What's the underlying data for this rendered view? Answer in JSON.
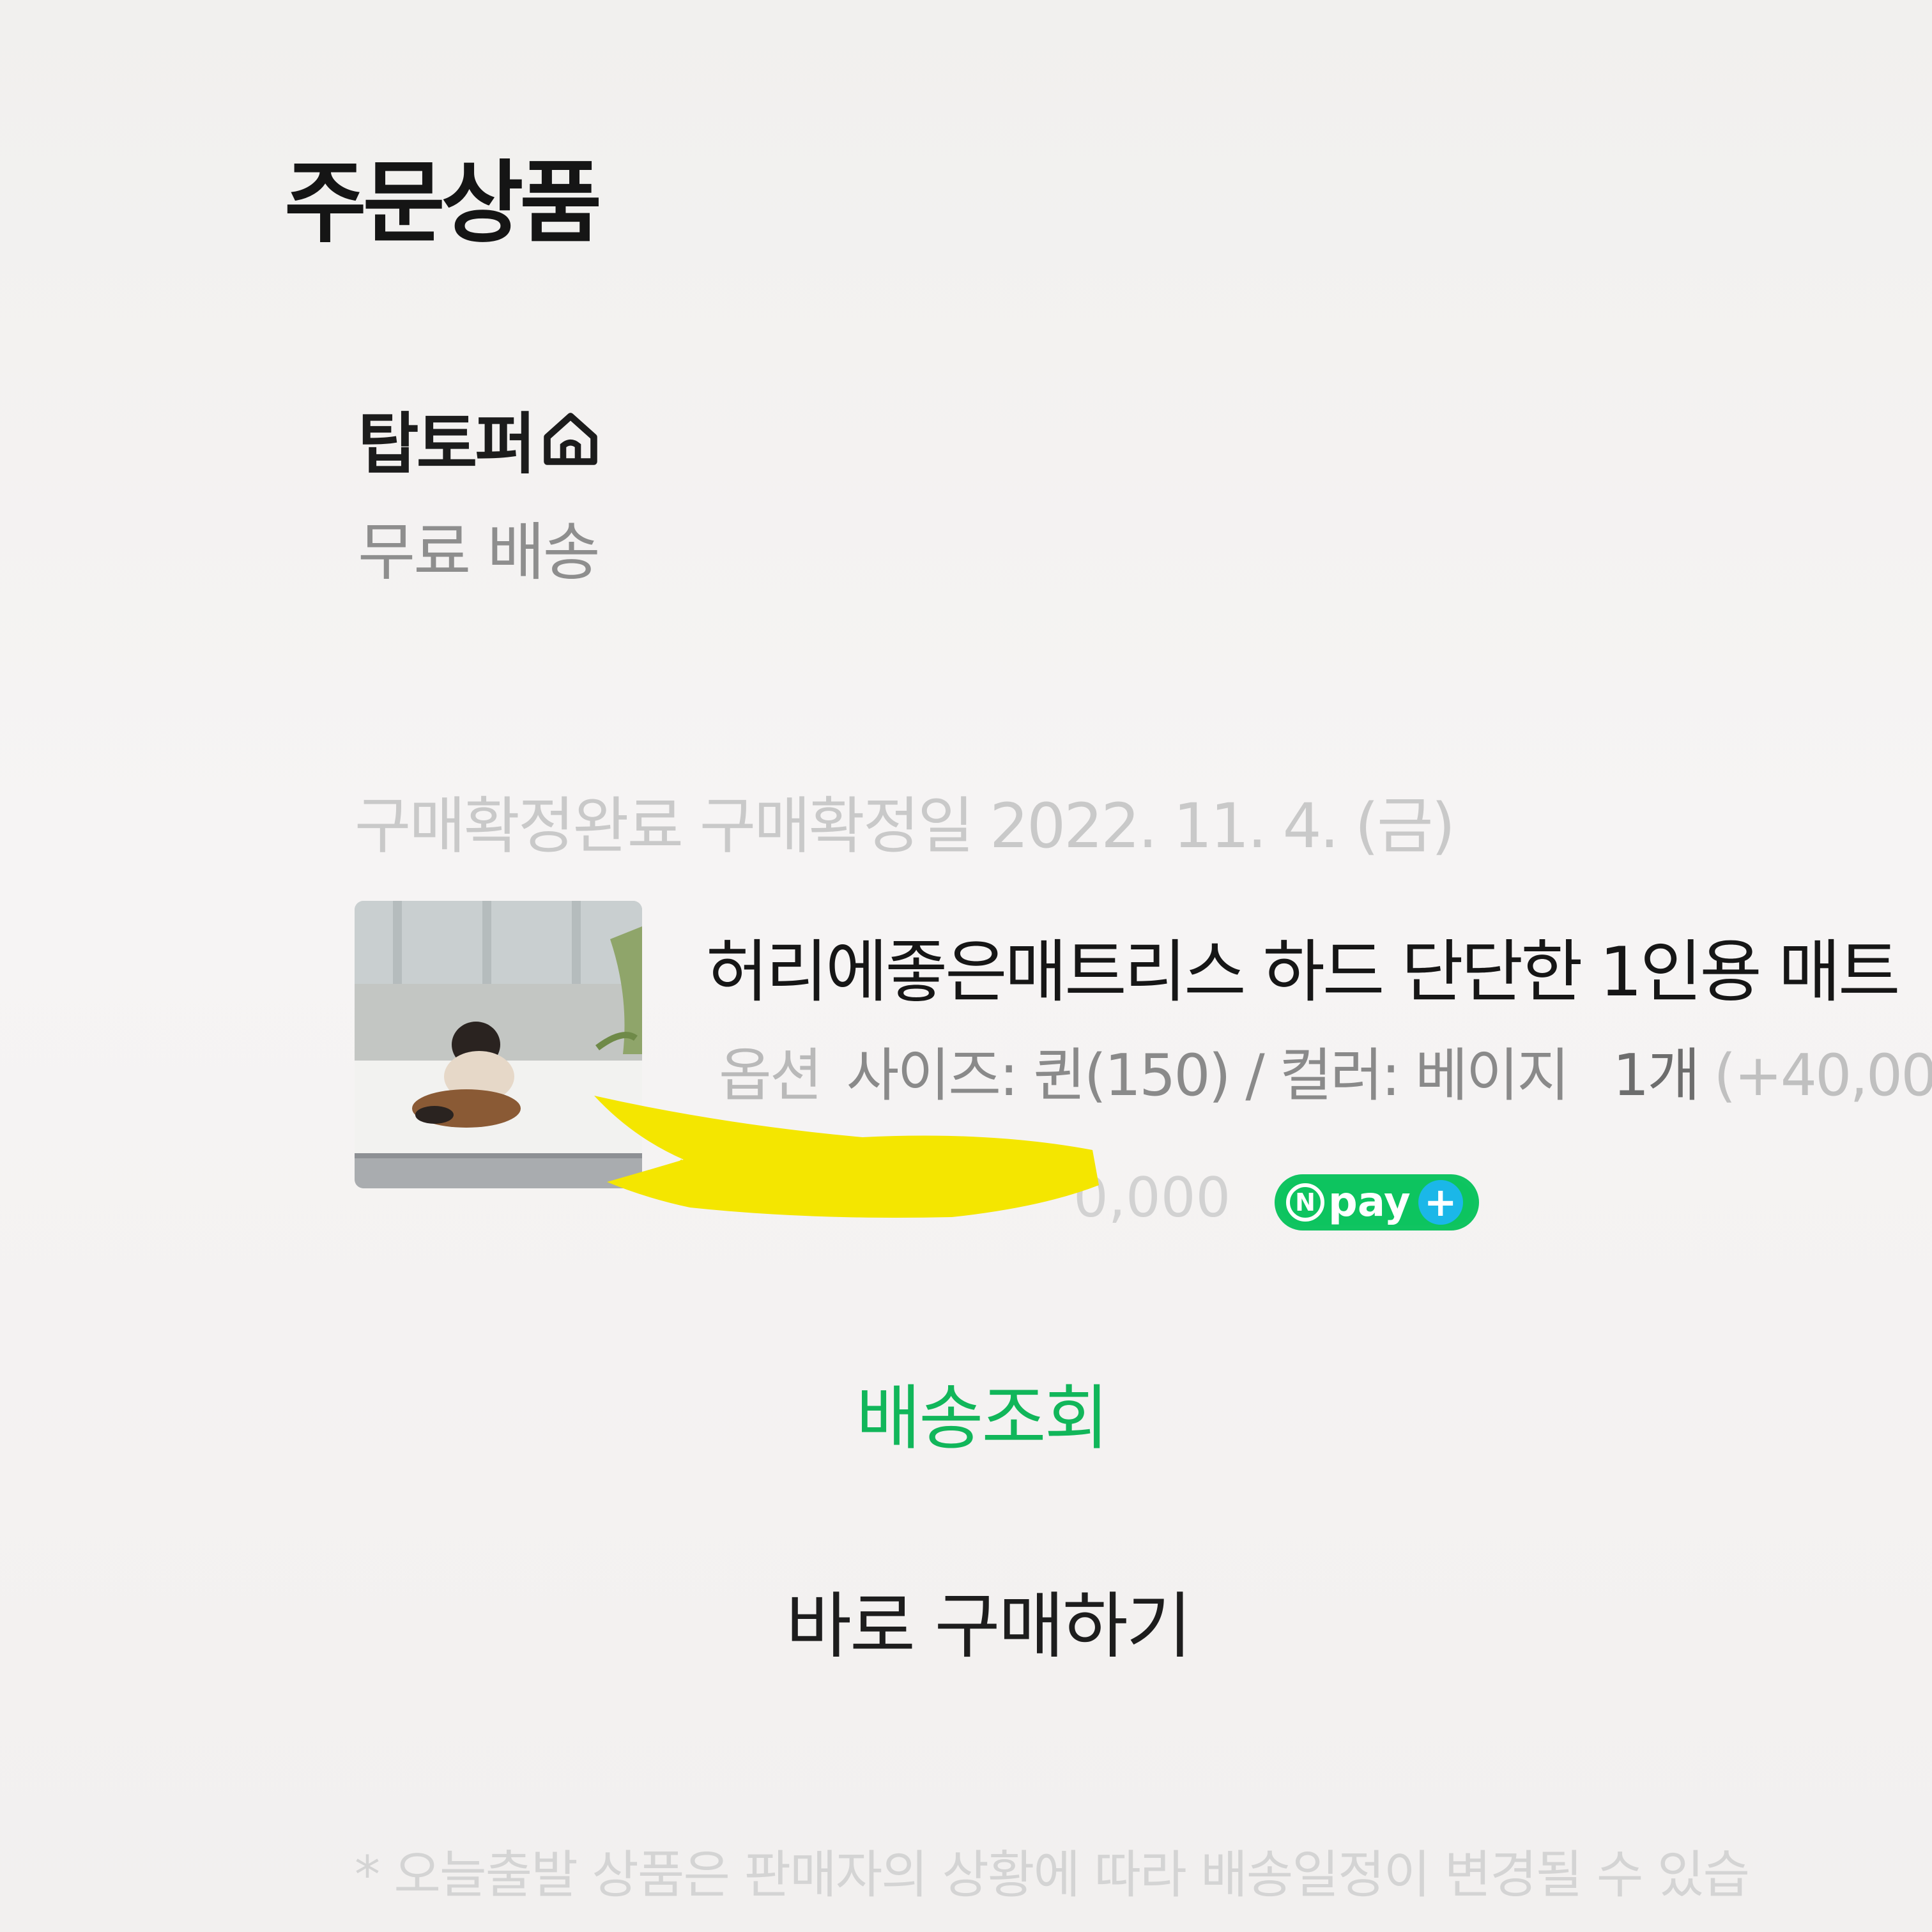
{
  "section": {
    "title": "주문상품"
  },
  "seller": {
    "name": "탑토퍼",
    "icon": "store-icon",
    "shipping": "무료 배송"
  },
  "order": {
    "status": "구매확정완료",
    "confirm_date": "구매확정일 2022. 11. 4. (금)"
  },
  "product": {
    "name": "허리에좋은매트리스 하드 단단한 1인용 매트",
    "option_label": "옵션",
    "option_value": "사이즈: 퀸(150) / 컬러: 베이지",
    "quantity": "1개",
    "option_extra": "(+40,00",
    "price_visible": "0,000",
    "badge": {
      "n_letter": "N",
      "text": "pay",
      "plus": "+"
    }
  },
  "actions": {
    "track_label": "배송조회",
    "buy_again_label": "바로 구매하기"
  },
  "footnote": "* 오늘출발 상품은 판매자의 상황에 따라 배송일정이 변경될 수 있습"
}
